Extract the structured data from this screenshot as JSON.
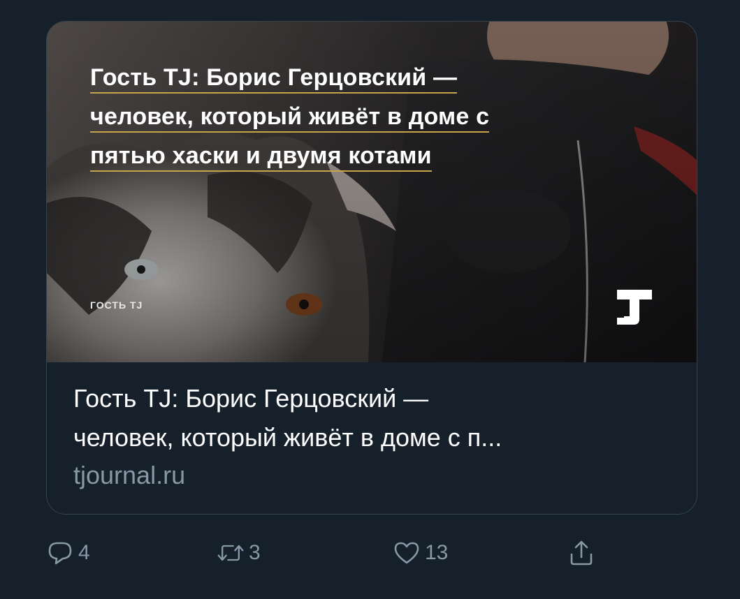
{
  "card": {
    "image": {
      "headline_lines": [
        "Гость TJ: Борис Герцовский —",
        "человек, который живёт в доме с",
        "пятью хаски и двумя котами"
      ],
      "kicker": "ГОСТЬ TJ",
      "logo_icon": "tj-logo-icon"
    },
    "title_lines": [
      "Гость TJ: Борис Герцовский —",
      "человек, который живёт в доме с п..."
    ],
    "domain": "tjournal.ru"
  },
  "actions": {
    "reply": {
      "icon": "reply-icon",
      "count": "4"
    },
    "retweet": {
      "icon": "retweet-icon",
      "count": "3"
    },
    "like": {
      "icon": "heart-icon",
      "count": "13"
    },
    "share": {
      "icon": "share-icon",
      "count": ""
    }
  },
  "colors": {
    "background": "#15202b",
    "border": "#38444d",
    "muted": "#8899a6",
    "text": "#ffffff",
    "underline": "#c8a44a"
  }
}
